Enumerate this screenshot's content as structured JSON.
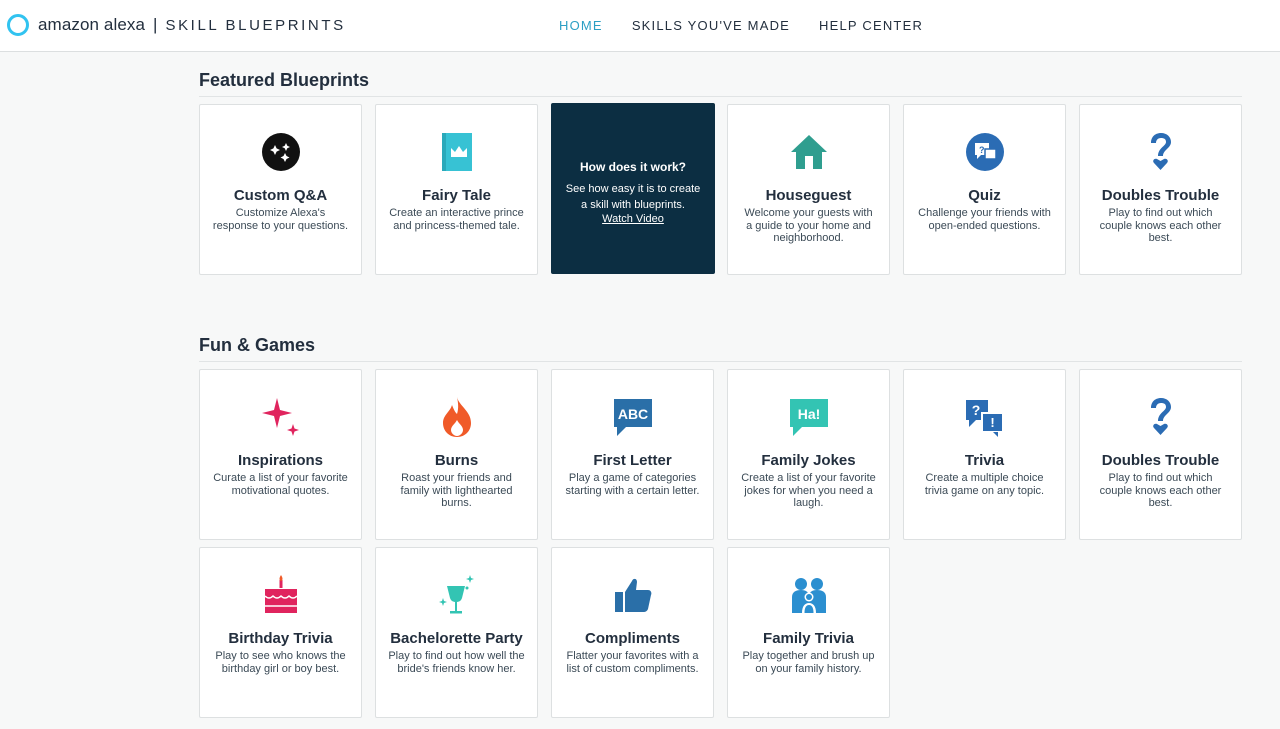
{
  "header": {
    "brand": "amazon alexa",
    "separator": "|",
    "product": "SKILL BLUEPRINTS",
    "nav": [
      {
        "label": "HOME",
        "active": true
      },
      {
        "label": "SKILLS YOU'VE MADE",
        "active": false
      },
      {
        "label": "HELP CENTER",
        "active": false
      }
    ]
  },
  "colors": {
    "accent": "#2c9fc4",
    "dark_card": "#0c2e42",
    "teal": "#37c2d4",
    "blue": "#2b6cb4",
    "green": "#2f9e8f",
    "pink": "#e0245e",
    "orange": "#f05a28"
  },
  "featured": {
    "title": "Featured Blueprints",
    "cards": [
      {
        "title": "Custom Q&A",
        "desc": "Customize Alexa's response to your questions.",
        "icon": "stars-circle-icon"
      },
      {
        "title": "Fairy Tale",
        "desc": "Create an interactive prince and princess-themed tale.",
        "icon": "crown-book-icon"
      },
      {
        "title": "Houseguest",
        "desc": "Welcome your guests with a guide to your home and neighborhood.",
        "icon": "house-icon"
      },
      {
        "title": "Quiz",
        "desc": "Challenge your friends with open-ended questions.",
        "icon": "quiz-bubble-icon"
      },
      {
        "title": "Doubles Trouble",
        "desc": "Play to find out which couple knows each other best.",
        "icon": "question-heart-icon"
      }
    ],
    "video": {
      "title": "How does it work?",
      "desc": "See how easy it is to create a skill with blueprints.",
      "link": "Watch Video"
    }
  },
  "fun": {
    "title": "Fun & Games",
    "cards": [
      {
        "title": "Inspirations",
        "desc": "Curate a list of your favorite motivational quotes.",
        "icon": "sparkle-icon"
      },
      {
        "title": "Burns",
        "desc": "Roast your friends and family with lighthearted burns.",
        "icon": "flame-icon"
      },
      {
        "title": "First Letter",
        "desc": "Play a game of categories starting with a certain letter.",
        "icon": "abc-bubble-icon"
      },
      {
        "title": "Family Jokes",
        "desc": "Create a list of your favorite jokes for when you need a laugh.",
        "icon": "ha-bubble-icon"
      },
      {
        "title": "Trivia",
        "desc": "Create a multiple choice trivia game on any topic.",
        "icon": "trivia-bubbles-icon"
      },
      {
        "title": "Doubles Trouble",
        "desc": "Play to find out which couple knows each other best.",
        "icon": "question-heart-icon"
      },
      {
        "title": "Birthday Trivia",
        "desc": "Play to see who knows the birthday girl or boy best.",
        "icon": "cake-icon"
      },
      {
        "title": "Bachelorette Party",
        "desc": "Play to find out how well the bride's friends know her.",
        "icon": "cocktail-icon"
      },
      {
        "title": "Compliments",
        "desc": "Flatter your favorites with a list of custom compliments.",
        "icon": "thumbs-up-icon"
      },
      {
        "title": "Family Trivia",
        "desc": "Play together and brush up on your family history.",
        "icon": "family-icon"
      }
    ]
  }
}
